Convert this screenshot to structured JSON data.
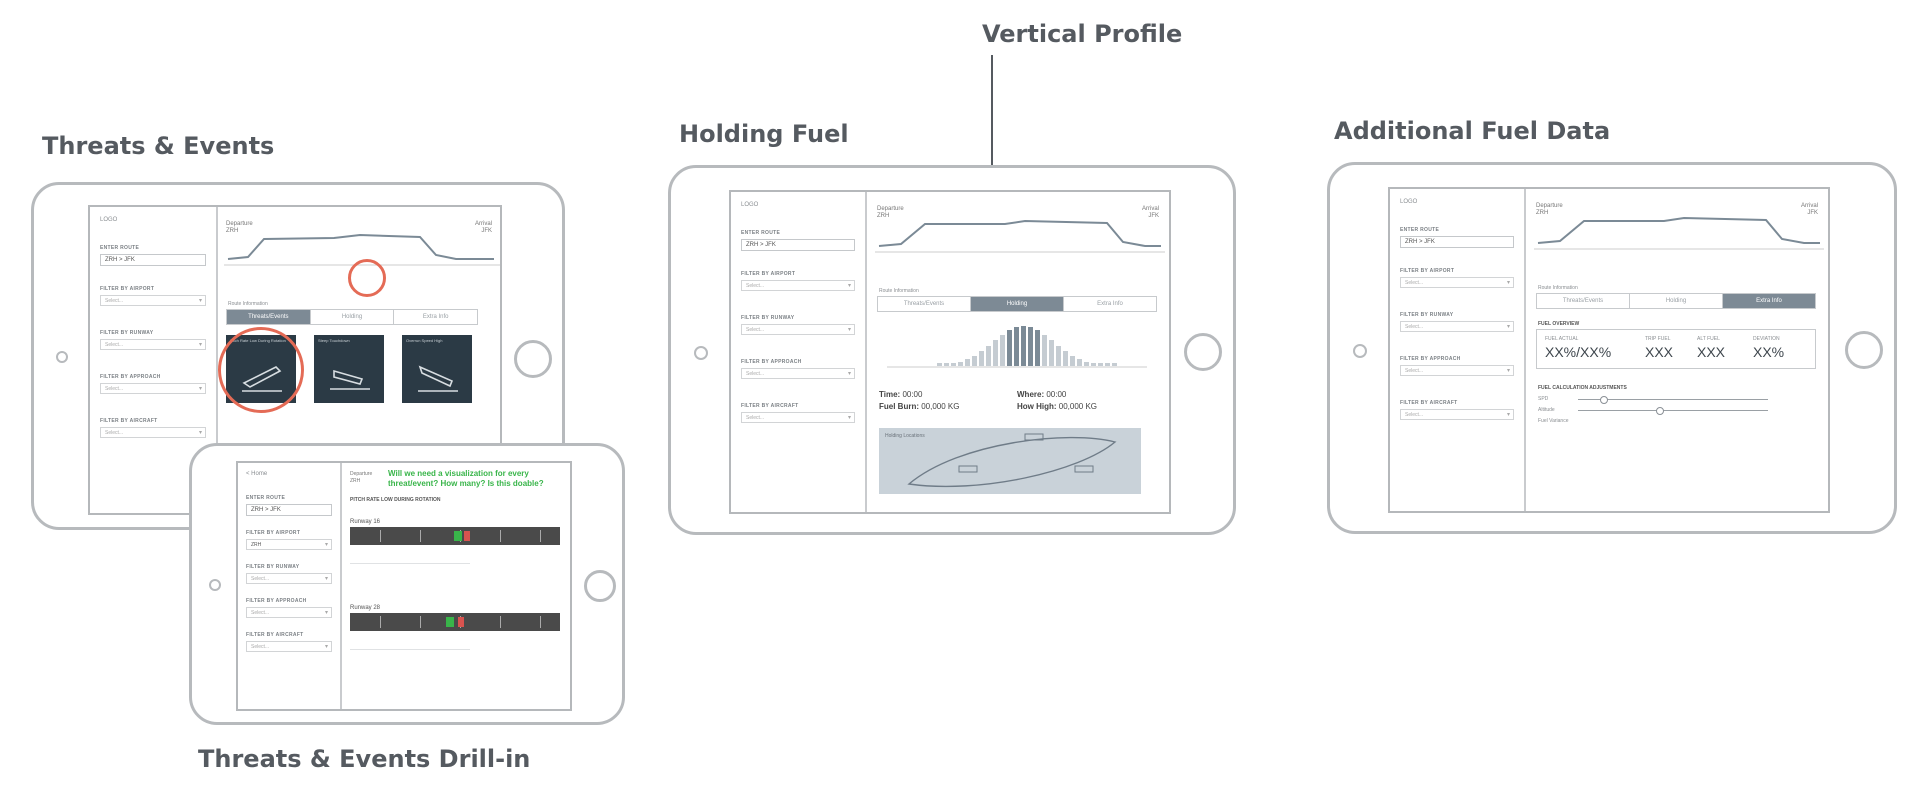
{
  "captions": {
    "threats": "Threats & Events",
    "holding": "Holding Fuel",
    "vertical": "Vertical Profile",
    "additional": "Additional Fuel Data",
    "drill": "Threats & Events Drill-in"
  },
  "sidebar": {
    "logo": "LOGO",
    "enter_route": "ENTER ROUTE",
    "route_value": "ZRH > JFK",
    "filter_airport": "FILTER BY AIRPORT",
    "filter_runway": "FILTER BY RUNWAY",
    "filter_approach": "FILTER BY APPROACH",
    "filter_aircraft": "FILTER BY AIRCRAFT",
    "select_placeholder": "Select..."
  },
  "drill_sidebar": {
    "back": "< Home",
    "airport_value": "ZRH"
  },
  "profile": {
    "departure_label": "Departure",
    "departure_code": "ZRH",
    "arrival_label": "Arrival",
    "arrival_code": "JFK"
  },
  "tabs": [
    "Threats/Events",
    "Holding",
    "Extra Info"
  ],
  "route_info_label": "Route Information",
  "threat_cards": [
    "Pitch Rate Low During Rotation",
    "Steep Touchdown",
    "Overrun Speed High"
  ],
  "drill": {
    "question": "Will we need a visualization for every threat/event? How many? Is this doable?",
    "heading": "PITCH RATE LOW DURING ROTATION",
    "runway1": "Runway 16",
    "runway2": "Runway 28"
  },
  "holding": {
    "time_label": "Time:",
    "time_value": "00:00",
    "where_label": "Where:",
    "where_value": "00:00",
    "fuel_label": "Fuel Burn:",
    "fuel_value": "00,000 KG",
    "high_label": "How High:",
    "high_value": "00,000 KG",
    "locations_label": "Holding Locations"
  },
  "additional": {
    "fuel_overview": "FUEL OVERVIEW",
    "col1_label": "FUEL ACTUAL",
    "col1_value": "XX%/XX%",
    "col2_label": "TRIP FUEL",
    "col2_value": "XXX",
    "col3_label": "ALT FUEL",
    "col3_value": "XXX",
    "col4_label": "DEVIATION",
    "col4_value": "XX%",
    "adjustments": "FUEL CALCULATION ADJUSTMENTS",
    "slider1": "SPD",
    "slider2": "Altitude",
    "slider3": "Fuel Variance"
  },
  "colors": {
    "accent_ring": "#e46b56",
    "card_dark": "#2b3a45",
    "question_green": "#39b54a",
    "tab_active": "#7d8a95"
  }
}
